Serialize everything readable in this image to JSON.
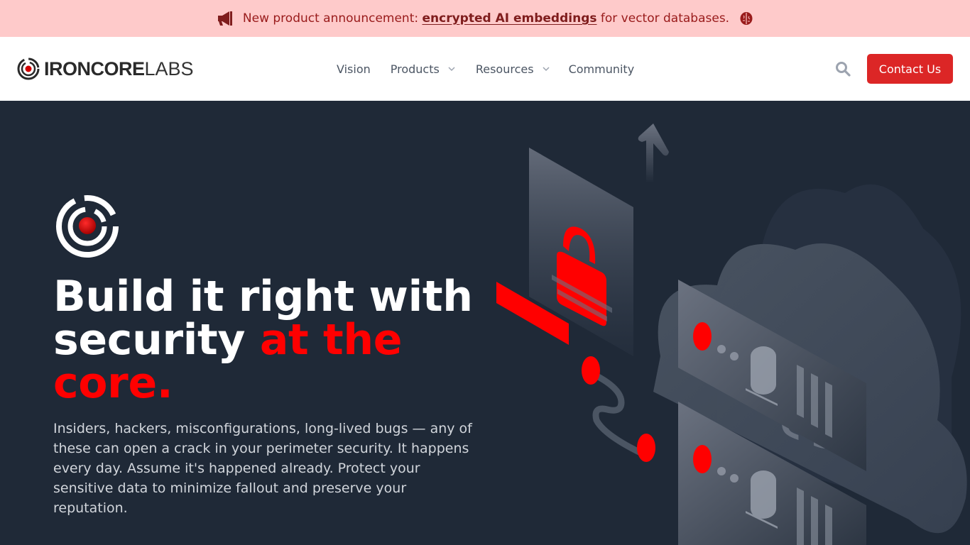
{
  "announcement": {
    "icon": "megaphone-icon",
    "prefix": "New product announcement: ",
    "link_text": "encrypted AI embeddings",
    "suffix": " for vector databases.",
    "trailing_icon": "brain-icon"
  },
  "header": {
    "logo_bold": "IRONCORE",
    "logo_light": "LABS",
    "nav": [
      {
        "label": "Vision",
        "has_dropdown": false
      },
      {
        "label": "Products",
        "has_dropdown": true
      },
      {
        "label": "Resources",
        "has_dropdown": true
      },
      {
        "label": "Community",
        "has_dropdown": false
      }
    ],
    "search_icon": "search-icon",
    "contact_label": "Contact Us"
  },
  "hero": {
    "headline_white": "Build it right with security ",
    "headline_red": "at the core.",
    "subtext": "Insiders, hackers, misconfigurations, long-lived bugs — any of these can open a crack in your perimeter security. It happens every day. Assume it's happened already. Protect your sensitive data to minimize fallout and preserve your reputation.",
    "illustration": "isometric-cloud-security-illustration"
  },
  "colors": {
    "announcement_bg": "#fecaca",
    "announcement_text": "#991b1b",
    "brand_red": "#dc2626",
    "accent_red": "#ff0000",
    "hero_bg": "#1f2937",
    "nav_text": "#4b5563"
  }
}
